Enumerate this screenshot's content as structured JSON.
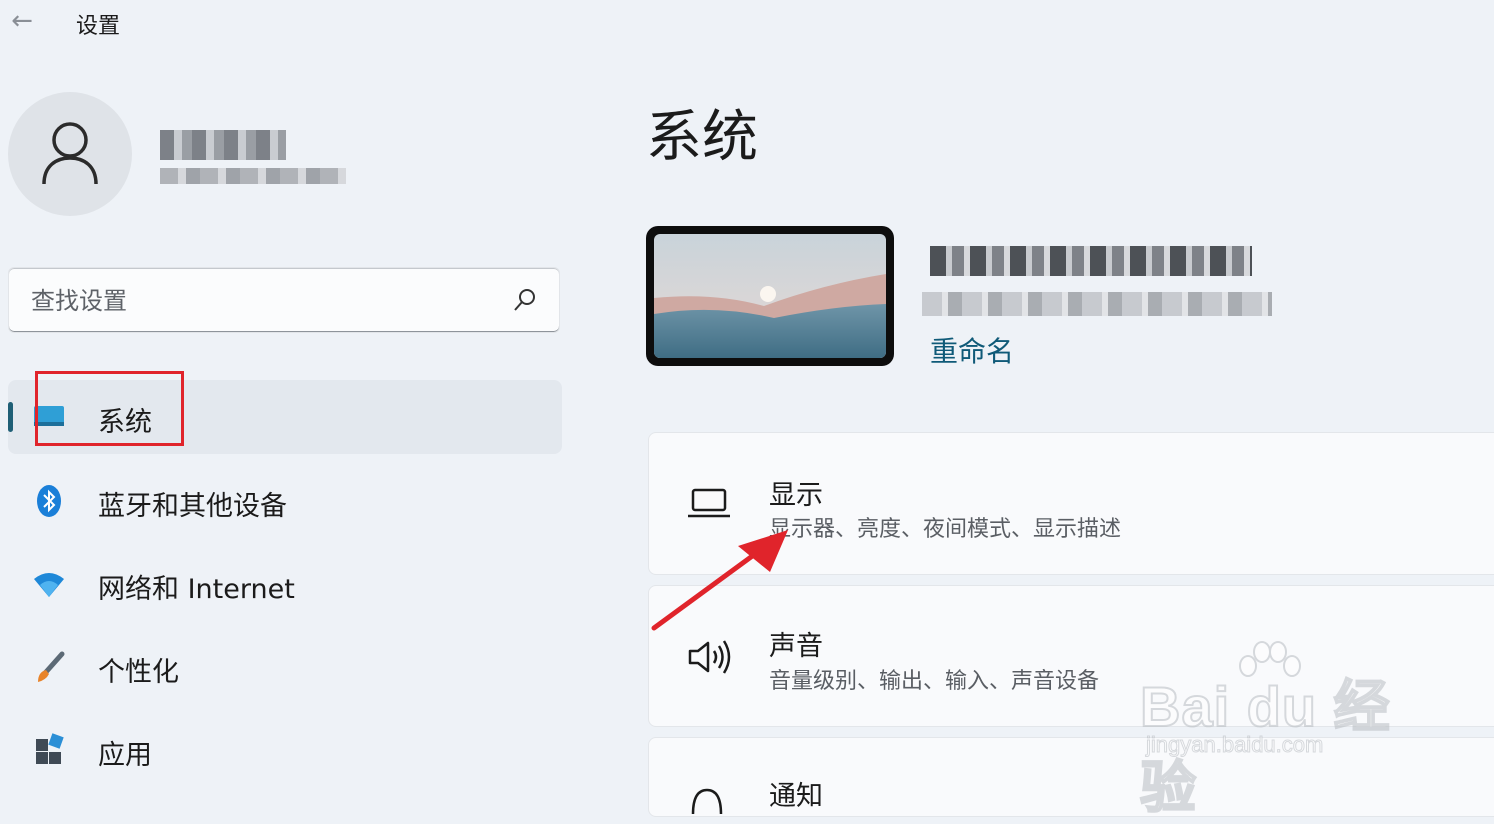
{
  "window": {
    "title": "设置",
    "back_icon": "arrow-left-icon"
  },
  "profile": {
    "avatar_icon": "person-icon"
  },
  "search": {
    "placeholder": "查找设置",
    "icon": "search-icon"
  },
  "sidebar": {
    "items": [
      {
        "label": "系统",
        "icon": "system-display-icon",
        "selected": true
      },
      {
        "label": "蓝牙和其他设备",
        "icon": "bluetooth-icon"
      },
      {
        "label": "网络和 Internet",
        "icon": "wifi-icon"
      },
      {
        "label": "个性化",
        "icon": "paintbrush-icon"
      },
      {
        "label": "应用",
        "icon": "apps-icon"
      }
    ]
  },
  "main": {
    "title": "系统",
    "device": {
      "rename_label": "重命名"
    },
    "cards": [
      {
        "title": "显示",
        "description": "显示器、亮度、夜间模式、显示描述",
        "icon": "laptop-icon"
      },
      {
        "title": "声音",
        "description": "音量级别、输出、输入、声音设备",
        "icon": "speaker-icon"
      },
      {
        "title": "通知",
        "description": "",
        "icon": "bell-icon"
      }
    ]
  },
  "watermark": {
    "logo": "Bai du 经验",
    "url": "jingyan.baidu.com"
  },
  "colors": {
    "accent": "#1f5f76",
    "link": "#0f5a78",
    "annotation_red": "#e0242b",
    "background": "#eef2f7"
  }
}
